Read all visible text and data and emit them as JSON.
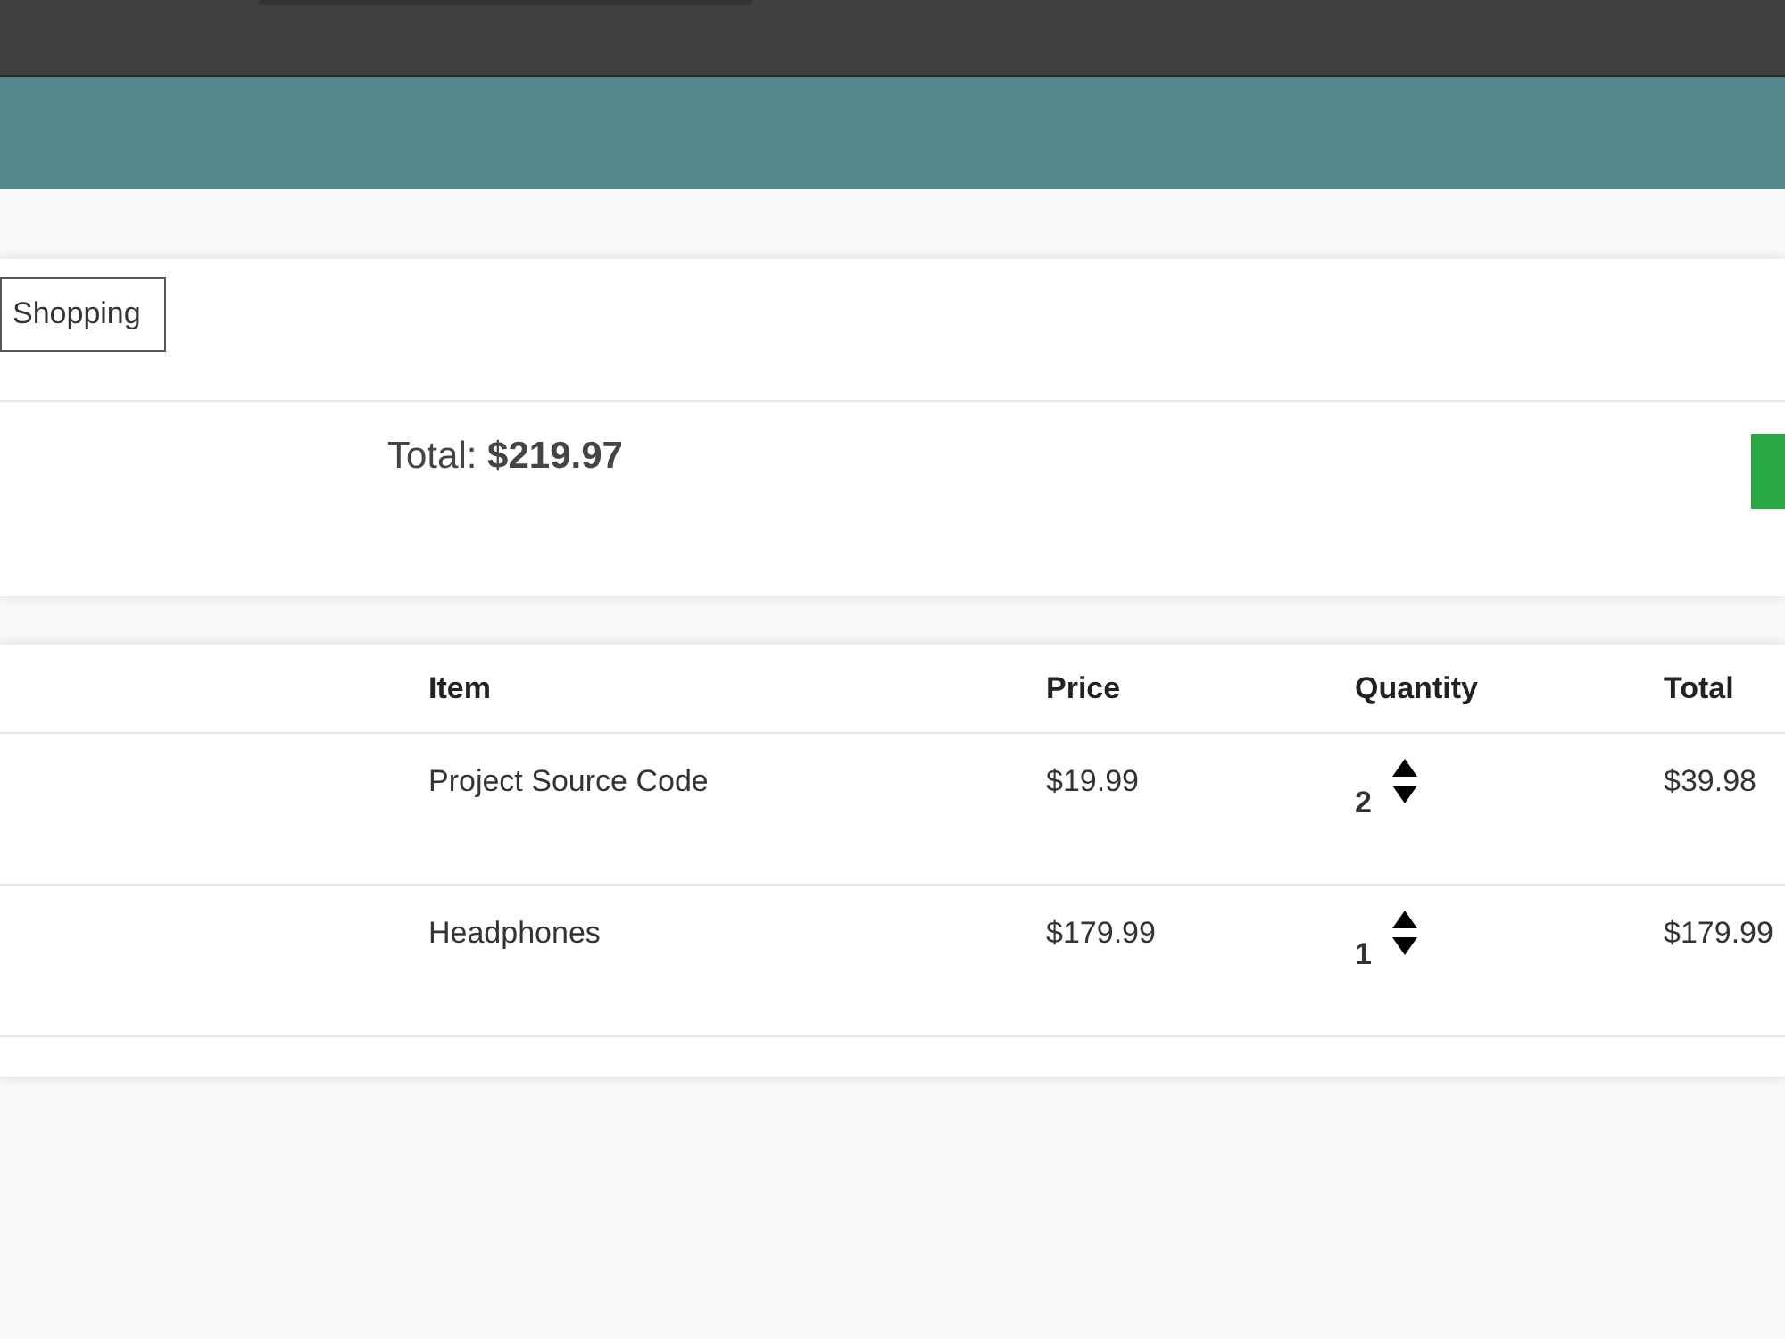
{
  "continue_button": {
    "label": "Shopping"
  },
  "summary": {
    "label": "Total:",
    "amount": "$219.97"
  },
  "table": {
    "columns": [
      "Item",
      "Price",
      "Quantity",
      "Total"
    ],
    "rows": [
      {
        "item": "Project Source Code",
        "price": "$19.99",
        "quantity": "2",
        "total": "$39.98"
      },
      {
        "item": "Headphones",
        "price": "$179.99",
        "quantity": "1",
        "total": "$179.99"
      }
    ]
  }
}
